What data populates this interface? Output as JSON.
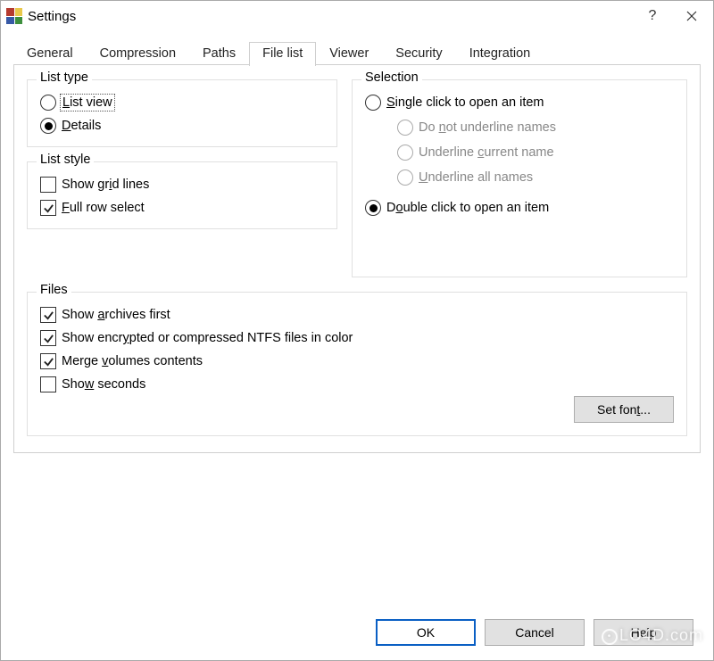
{
  "window": {
    "title": "Settings"
  },
  "tabs": {
    "general": "General",
    "compression": "Compression",
    "paths": "Paths",
    "filelist": "File list",
    "viewer": "Viewer",
    "security": "Security",
    "integration": "Integration"
  },
  "groups": {
    "list_type": {
      "legend": "List type",
      "list_view_html": "<u>L</u>ist view",
      "details_html": "<u>D</u>etails",
      "selected": "details"
    },
    "list_style": {
      "legend": "List style",
      "show_grid_html": "Show gr<u>i</u>d lines",
      "full_row_html": "<u>F</u>ull row select",
      "show_grid_checked": false,
      "full_row_checked": true
    },
    "selection": {
      "legend": "Selection",
      "single_click_html": "<u>S</u>ingle click to open an item",
      "no_underline_html": "Do <u>n</u>ot underline names",
      "underline_current_html": "Underline <u>c</u>urrent name",
      "underline_all_html": "<u>U</u>nderline all names",
      "double_click_html": "D<u>o</u>uble click to open an item",
      "selected": "double"
    },
    "files": {
      "legend": "Files",
      "show_archives_html": "Show <u>a</u>rchives first",
      "show_encrypted_html": "Show encr<u>y</u>pted or compressed NTFS files in color",
      "merge_volumes_html": "Merge <u>v</u>olumes contents",
      "show_seconds_html": "Sho<u>w</u> seconds",
      "show_archives_checked": true,
      "show_encrypted_checked": true,
      "merge_volumes_checked": true,
      "show_seconds_checked": false,
      "set_font_html": "Set fon<u>t</u>..."
    }
  },
  "buttons": {
    "ok": "OK",
    "cancel": "Cancel",
    "help": "Help"
  },
  "watermark": "LO4D.com"
}
